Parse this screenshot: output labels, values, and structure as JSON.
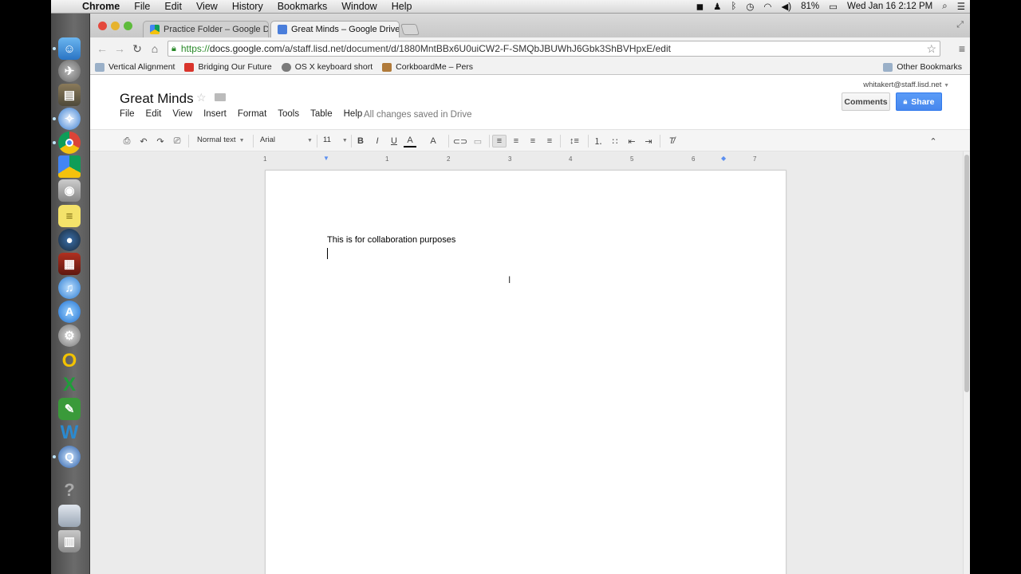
{
  "menubar": {
    "app_name": "Chrome",
    "items": [
      "File",
      "Edit",
      "View",
      "History",
      "Bookmarks",
      "Window",
      "Help"
    ],
    "battery": "81%",
    "datetime": "Wed Jan 16  2:12 PM"
  },
  "dock": {
    "icons": [
      "finder-icon",
      "launchpad-icon",
      "file-manager-icon",
      "safari-icon",
      "chrome-icon",
      "google-drive-icon",
      "photo-booth-icon",
      "stickies-icon",
      "webcam-icon",
      "photo-icon",
      "itunes-icon",
      "app-store-icon",
      "system-preferences-icon",
      "o-app-icon",
      "excel-icon",
      "evernote-icon",
      "word-icon",
      "quicktime-icon",
      "help-icon",
      "folder-icon",
      "trash-icon"
    ]
  },
  "tabs": [
    {
      "title": "Practice Folder – Google Dri",
      "active": false
    },
    {
      "title": "Great Minds – Google Drive",
      "active": true
    }
  ],
  "address_bar": {
    "scheme": "https://",
    "host": "docs.google.com",
    "path": "/a/staff.lisd.net/document/d/1880MntBBx6U0uiCW2-F-SMQbJBUWhJ6Gbk3ShBVHpxE/edit"
  },
  "bookmarks": [
    {
      "label": "Vertical Alignment",
      "color": "#9ab0c8"
    },
    {
      "label": "Bridging Our Future",
      "color": "#d9342b"
    },
    {
      "label": "OS X keyboard short",
      "color": "#7a7a7a"
    },
    {
      "label": "CorkboardMe – Pers",
      "color": "#b07a3a"
    }
  ],
  "bookmarks_other": "Other Bookmarks",
  "doc": {
    "title": "Great Minds",
    "menus": [
      "File",
      "Edit",
      "View",
      "Insert",
      "Format",
      "Tools",
      "Table",
      "Help"
    ],
    "save_status": "All changes saved in Drive",
    "account": "whitakert@staff.lisd.net",
    "comments_label": "Comments",
    "share_label": "Share",
    "style_value": "Normal text",
    "font_value": "Arial",
    "size_value": "11",
    "body_text": "This is for collaboration purposes"
  },
  "ruler_labels": [
    "1",
    "1",
    "2",
    "3",
    "4",
    "5",
    "6",
    "7"
  ],
  "colors": {
    "share_blue": "#4787ed",
    "menubar_bg": "#e6e6e6",
    "workspace_bg": "#ebebeb"
  }
}
